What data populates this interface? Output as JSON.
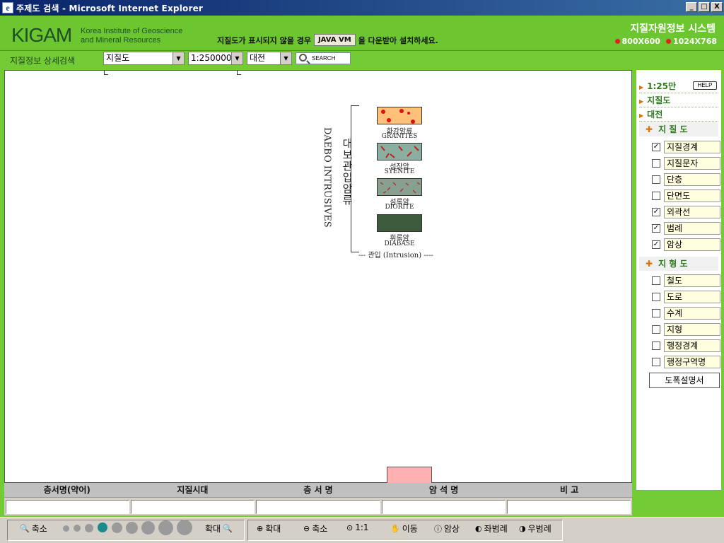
{
  "window": {
    "title": "주제도 검색 - Microsoft Internet Explorer",
    "btn_min": "_",
    "btn_max": "□",
    "btn_close": "X",
    "ie_glyph": "e"
  },
  "header": {
    "logo": "KIGAM",
    "logo_sub1": "Korea Institute of Geoscience",
    "logo_sub2": "and Mineral Resources",
    "java_msg_pre": "지질도가 표시되지 않을 경우",
    "java_btn": "JAVA VM",
    "java_msg_post": "을 다운받아 설치하세요.",
    "system_title": "지질자원정보 시스템",
    "res1": "800X600",
    "res2": "1024X768"
  },
  "searchbar": {
    "label": "지질정보 상세검색",
    "map_type": "지질도",
    "scale": "1:250000",
    "region": "대전",
    "search_label": "SEARCH"
  },
  "legend": {
    "group_ko": "대보관입암류",
    "group_en": "DAEBO INTRUSIVES",
    "items": [
      {
        "ko": "화강암류",
        "en": "GRANITES"
      },
      {
        "ko": "섬장암",
        "en": "SYENITE"
      },
      {
        "ko": "섬록암",
        "en": "DIORITE"
      },
      {
        "ko": "휘록암",
        "en": "DIABASE"
      }
    ],
    "intrusion": "--- 관입 (Intrusion) ----"
  },
  "table": {
    "headers": [
      "층서명(약어)",
      "지질시대",
      "층 서 명",
      "암 석 명",
      "비  고"
    ]
  },
  "rpanel": {
    "nav": [
      "1:25만",
      "지질도",
      "대전"
    ],
    "help": "HELP",
    "sec_geology": "지 질 도",
    "geology_items": [
      {
        "label": "지질경계",
        "checked": "✓"
      },
      {
        "label": "지질문자",
        "checked": ""
      },
      {
        "label": "단층",
        "checked": ""
      },
      {
        "label": "단면도",
        "checked": ""
      },
      {
        "label": "외곽선",
        "checked": "✓"
      },
      {
        "label": "범례",
        "checked": "✓"
      },
      {
        "label": "암상",
        "checked": "✓"
      }
    ],
    "sec_topo": "지 형 도",
    "topo_items": [
      {
        "label": "철도",
        "checked": ""
      },
      {
        "label": "도로",
        "checked": ""
      },
      {
        "label": "수계",
        "checked": ""
      },
      {
        "label": "지형",
        "checked": ""
      },
      {
        "label": "행정경계",
        "checked": ""
      },
      {
        "label": "행정구역명",
        "checked": ""
      }
    ],
    "desc_btn": "도폭설명서"
  },
  "statusbar": {
    "zoom_out": "축소",
    "zoom_in": "확대",
    "tools": [
      "확대",
      "축소",
      "1:1",
      "이동",
      "암상",
      "좌범례",
      "우범례"
    ]
  }
}
